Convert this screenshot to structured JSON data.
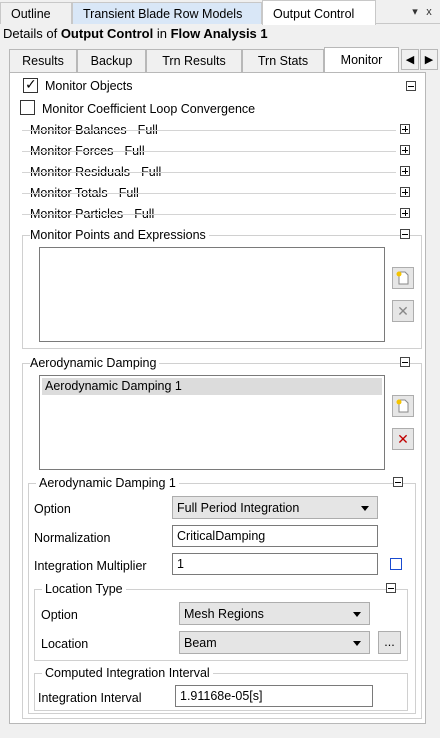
{
  "top_tabs": [
    "Outline",
    "Transient Blade Row Models",
    "Output Control"
  ],
  "window_buttons": [
    "▾",
    "x"
  ],
  "details": {
    "prefix": "Details of ",
    "object": "Output Control",
    "mid": " in ",
    "parent": "Flow Analysis 1"
  },
  "inner_tabs": [
    "Results",
    "Backup",
    "Trn Results",
    "Trn Stats",
    "Monitor"
  ],
  "monitor_objects": {
    "label": "Monitor Objects",
    "checked": true
  },
  "coeff_loop": {
    "label": "Monitor Coefficient Loop Convergence",
    "checked": false
  },
  "sections": [
    "Monitor Balances - Full",
    "Monitor Forces - Full",
    "Monitor Residuals - Full",
    "Monitor Totals - Full",
    "Monitor Particles - Full"
  ],
  "points_section": "Monitor Points and Expressions",
  "aero": {
    "section": "Aerodynamic Damping",
    "items": [
      "Aerodynamic Damping 1"
    ],
    "sub_title": "Aerodynamic Damping 1",
    "option_label": "Option",
    "option_value": "Full Period Integration",
    "normalization_label": "Normalization",
    "normalization_value": "CriticalDamping",
    "multiplier_label": "Integration Multiplier",
    "multiplier_value": "1",
    "location_type": {
      "title": "Location Type",
      "option_label": "Option",
      "option_value": "Mesh Regions",
      "location_label": "Location",
      "location_value": "Beam",
      "browse": "..."
    },
    "computed": {
      "title": "Computed Integration Interval",
      "label": "Integration Interval",
      "value": "1.91168e-05[s]"
    }
  }
}
